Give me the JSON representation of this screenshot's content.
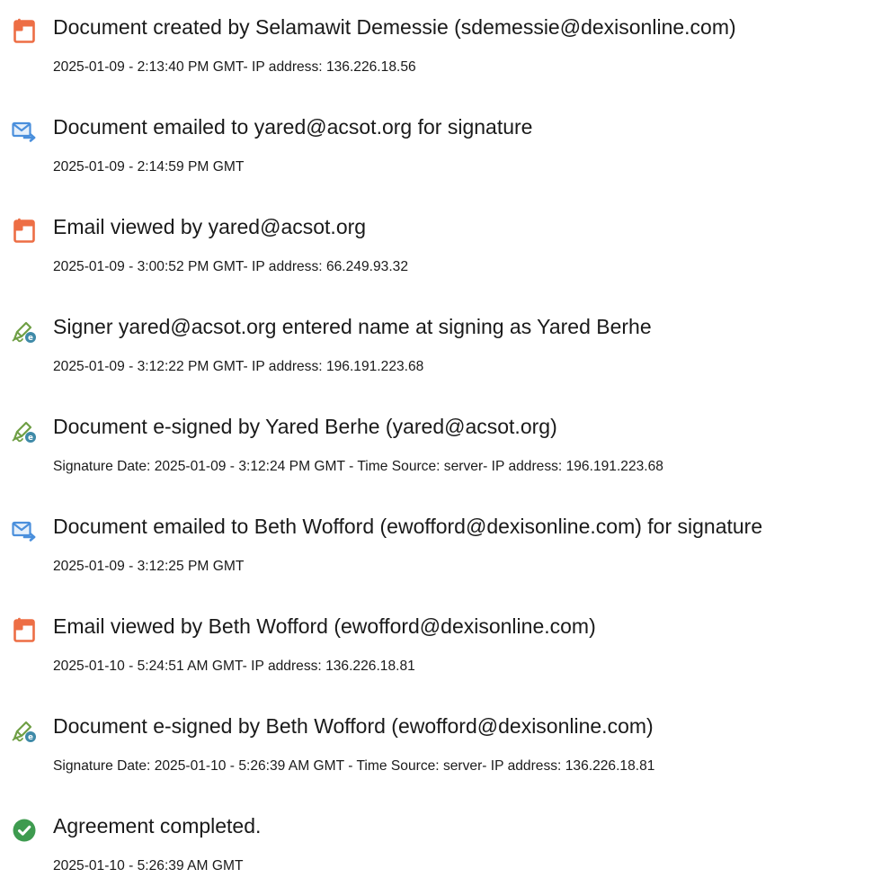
{
  "colors": {
    "document_icon": "#ed6e45",
    "email_icon": "#4a8fdc",
    "sign_icon_pen": "#6f9f45",
    "sign_icon_badge": "#3f8aa8",
    "complete_icon": "#3e9b4f",
    "text": "#1a1a1a"
  },
  "events": [
    {
      "icon": "document-icon",
      "title": "Document created by Selamawit Demessie (sdemessie@dexisonline.com)",
      "detail": "2025-01-09 - 2:13:40 PM GMT- IP address: 136.226.18.56"
    },
    {
      "icon": "email-icon",
      "title": "Document emailed to yared@acsot.org for signature",
      "detail": "2025-01-09 - 2:14:59 PM GMT"
    },
    {
      "icon": "document-icon",
      "title": "Email viewed by yared@acsot.org",
      "detail": "2025-01-09 - 3:00:52 PM GMT- IP address: 66.249.93.32"
    },
    {
      "icon": "signature-pen-icon",
      "title": "Signer yared@acsot.org entered name at signing as Yared Berhe",
      "detail": "2025-01-09 - 3:12:22 PM GMT- IP address: 196.191.223.68"
    },
    {
      "icon": "signature-pen-icon",
      "title": "Document e-signed by Yared Berhe (yared@acsot.org)",
      "detail": "Signature Date: 2025-01-09 - 3:12:24 PM GMT - Time Source: server- IP address: 196.191.223.68"
    },
    {
      "icon": "email-icon",
      "title": "Document emailed to Beth Wofford (ewofford@dexisonline.com) for signature",
      "detail": "2025-01-09 - 3:12:25 PM GMT"
    },
    {
      "icon": "document-icon",
      "title": "Email viewed by Beth Wofford (ewofford@dexisonline.com)",
      "detail": "2025-01-10 - 5:24:51 AM GMT- IP address: 136.226.18.81"
    },
    {
      "icon": "signature-pen-icon",
      "title": "Document e-signed by Beth Wofford (ewofford@dexisonline.com)",
      "detail": "Signature Date: 2025-01-10 - 5:26:39 AM GMT - Time Source: server- IP address: 136.226.18.81"
    },
    {
      "icon": "checkmark-circle-icon",
      "title": "Agreement completed.",
      "detail": "2025-01-10 - 5:26:39 AM GMT"
    }
  ]
}
